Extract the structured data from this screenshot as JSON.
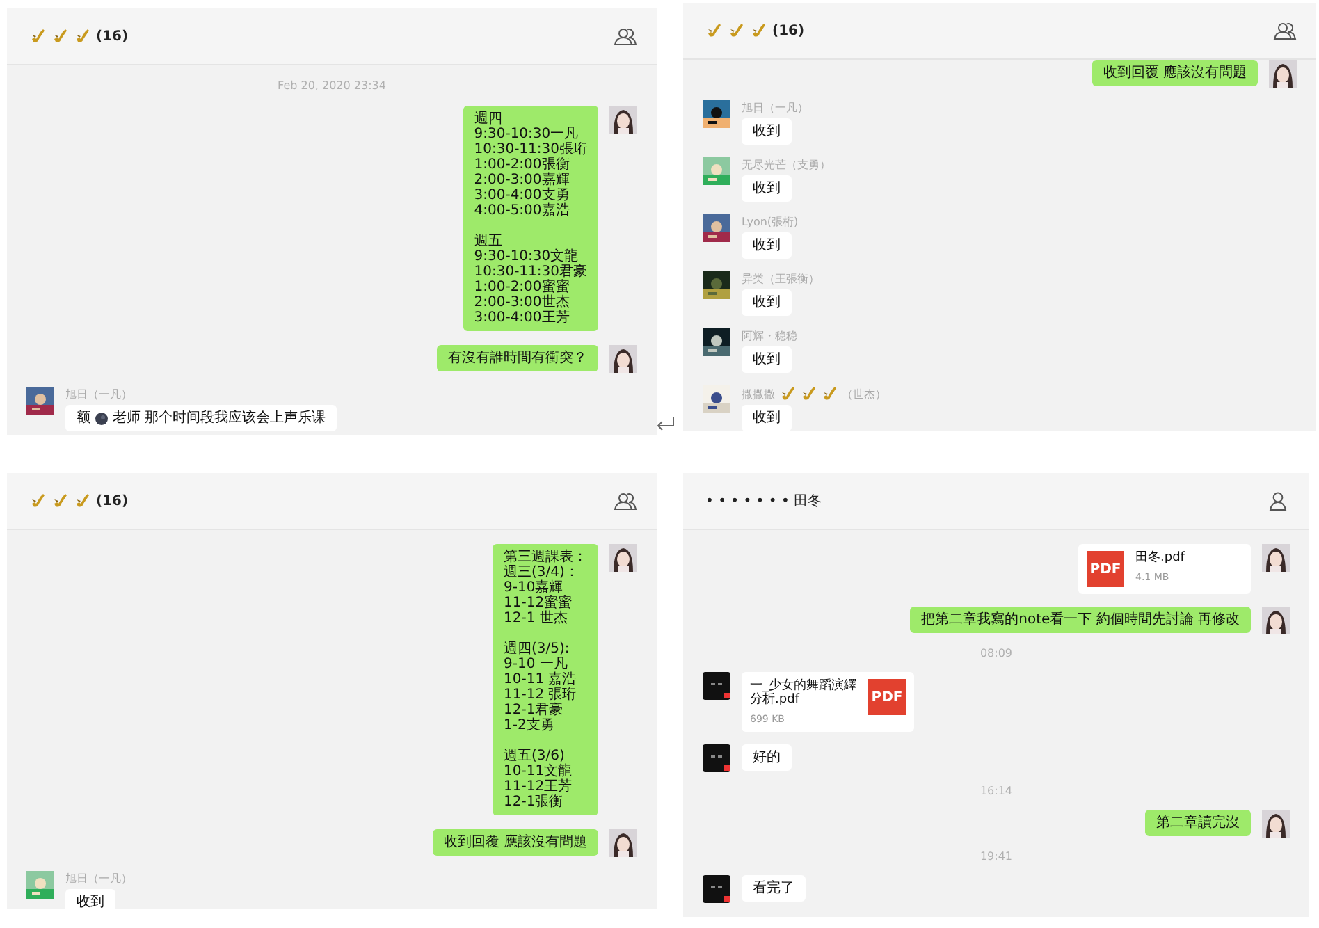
{
  "panels": [
    {
      "kind": "group",
      "title": "(16)",
      "messages": [
        {
          "kind": "time",
          "text": "Feb 20, 2020 23:34"
        },
        {
          "kind": "out",
          "blocks": [
            [
              "週四",
              "9:30-10:30一凡",
              "10:30-11:30張珩",
              "1:00-2:00張衡",
              "2:00-3:00嘉輝",
              "3:00-4:00支勇",
              "4:00-5:00嘉浩"
            ],
            [
              "週五",
              "9:30-10:30文龍",
              "10:30-11:30君豪",
              "1:00-2:00蜜蜜",
              "2:00-3:00世杰",
              "3:00-4:00王芳"
            ]
          ]
        },
        {
          "kind": "out",
          "text": "有沒有誰時間有衝突？"
        },
        {
          "kind": "in",
          "sender": [
            {
              "kind": "text",
              "text": "旭日（一凡）"
            }
          ],
          "parts": [
            {
              "kind": "text",
              "text": "额"
            },
            {
              "kind": "moon"
            },
            {
              "kind": "text",
              "text": "老师  那个时间段我应该会上声乐课"
            }
          ]
        }
      ]
    },
    {
      "kind": "group",
      "title": "(16)",
      "messages": [
        {
          "kind": "out",
          "text": "收到回覆 應該沒有問題"
        },
        {
          "kind": "in",
          "sender": [
            {
              "kind": "text",
              "text": "旭日（一凡）"
            }
          ],
          "parts": [
            {
              "kind": "text",
              "text": "收到"
            }
          ]
        },
        {
          "kind": "in",
          "sender": [
            {
              "kind": "text",
              "text": "无尽光芒（支勇）"
            }
          ],
          "parts": [
            {
              "kind": "text",
              "text": "收到"
            }
          ]
        },
        {
          "kind": "in",
          "sender": [
            {
              "kind": "text",
              "text": "Lyon(張桁)"
            }
          ],
          "parts": [
            {
              "kind": "text",
              "text": "收到"
            }
          ]
        },
        {
          "kind": "in",
          "sender": [
            {
              "kind": "text",
              "text": "异类（王張衡）"
            }
          ],
          "parts": [
            {
              "kind": "text",
              "text": "收到"
            }
          ]
        },
        {
          "kind": "in",
          "sender": [
            {
              "kind": "text",
              "text": "阿辉・稳稳"
            }
          ],
          "parts": [
            {
              "kind": "text",
              "text": "收到"
            }
          ]
        },
        {
          "kind": "in",
          "sender": [
            {
              "kind": "text",
              "text": "撒撒撒"
            },
            {
              "kind": "sax"
            },
            {
              "kind": "text",
              "text": "（世杰）"
            }
          ],
          "parts": [
            {
              "kind": "text",
              "text": "收到"
            }
          ]
        }
      ]
    },
    {
      "kind": "group",
      "title": "(16)",
      "messages": [
        {
          "kind": "out",
          "blocks": [
            [
              "第三週課表：",
              "週三(3/4)：",
              "9-10嘉輝",
              "11-12蜜蜜",
              "12-1 世杰"
            ],
            [
              "週四(3/5):",
              "9-10 一凡",
              "10-11 嘉浩",
              "11-12 張珩",
              "12-1君豪",
              "1-2支勇"
            ],
            [
              "週五(3/6)",
              "10-11文龍",
              "11-12王芳",
              "12-1張衡"
            ]
          ]
        },
        {
          "kind": "out",
          "text": "收到回覆 應該沒有問題"
        },
        {
          "kind": "in",
          "sender": [
            {
              "kind": "text",
              "text": "旭日（一凡）"
            }
          ],
          "parts": [
            {
              "kind": "text",
              "text": "收到"
            }
          ]
        }
      ]
    },
    {
      "kind": "single",
      "title": "• • • • • • • 田冬",
      "messages": [
        {
          "kind": "file_out",
          "name": "田冬.pdf",
          "size": "4.1 MB",
          "badge": "PDF"
        },
        {
          "kind": "out",
          "text": "把第二章我寫的note看一下 約個時間先討論 再修改"
        },
        {
          "kind": "time",
          "text": "08:09"
        },
        {
          "kind": "file_in",
          "name": "一_少女的舞蹈演繹分析.pdf",
          "size": "699 KB",
          "badge": "PDF"
        },
        {
          "kind": "in",
          "parts": [
            {
              "kind": "text",
              "text": "好的"
            }
          ]
        },
        {
          "kind": "time",
          "text": "16:14"
        },
        {
          "kind": "out",
          "text": "第二章讀完沒"
        },
        {
          "kind": "time",
          "text": "19:41"
        },
        {
          "kind": "in",
          "parts": [
            {
              "kind": "text",
              "text": "看完了"
            }
          ]
        }
      ]
    }
  ]
}
